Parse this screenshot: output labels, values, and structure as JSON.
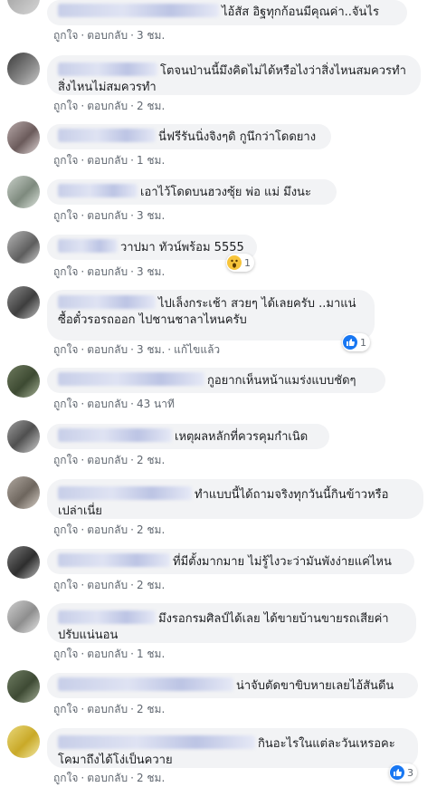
{
  "comments": [
    {
      "text": "ไอ้สัส อิฐทุกก้อนมีคุณค่า..จันไร",
      "time": "3 ชม."
    },
    {
      "text": "โตจนป่านนี้มึงคิดไม่ได้หรือไงว่าสิ่งไหนสมควรทำสิ่งไหนไม่สมควรทำ",
      "time": "2 ชม."
    },
    {
      "text": "นี่ฟรีรันนิ่งจิงๆดิ กูนึกว่าโดดยาง",
      "time": "1 ชม."
    },
    {
      "text": "เอาไว้โดดบนฮวงซุ้ย พ่อ แม่ มึงนะ",
      "time": "3 ชม."
    },
    {
      "text": "วาปมา ทัวน์พร้อม 5555",
      "time": "3 ชม.",
      "reaction_count": "1"
    },
    {
      "text": "ไปเล็งกระเช้า สวยๆ ได้เลยครับ ..มาแน่ ซื้อตั๋วรอรถออก ไปชานชาลาไหนครับ",
      "time": "3 ชม.",
      "edited": "แก้ไขแล้ว",
      "reaction_count": "1"
    },
    {
      "text": "กูอยากเห็นหน้าแมร่งแบบชัดๆ",
      "time": "43 นาที"
    },
    {
      "text": "เหตุผลหลักที่ควรคุมกำเนิด",
      "time": "2 ชม."
    },
    {
      "text": "ทำแบบนี้ได้ถามจริงทุกวันนี้กินข้าวหรือเปล่าเนี่ย",
      "time": "2 ชม."
    },
    {
      "text": "ที่มีตั้งมากมาย ไม่รู้ไงวะว่ามันพังง่ายแค่ไหน",
      "time": "2 ชม."
    },
    {
      "text": "มึงรอกรมศิลป์ได้เลย ได้ขายบ้านขายรถเสียค่าปรับแน่นอน",
      "time": "1 ชม."
    },
    {
      "text": "น่าจับตัดขาขิบหายเลยไอ้สันดีน",
      "time": "2 ชม."
    },
    {
      "text": "กินอะไรในแต่ละวันเหรอคะ โคมาถึงได้โง่เป็นควาย",
      "time": "2 ชม.",
      "reaction_count": "3"
    }
  ],
  "actions": {
    "like": "ถูกใจ",
    "reply": "ตอบกลับ",
    "sep": "·"
  },
  "icons": {
    "like": "like-icon",
    "wow": "wow-icon"
  },
  "colors": {
    "bubble": "#f2f3f5",
    "meta": "#606770",
    "like": "#1877f2"
  }
}
